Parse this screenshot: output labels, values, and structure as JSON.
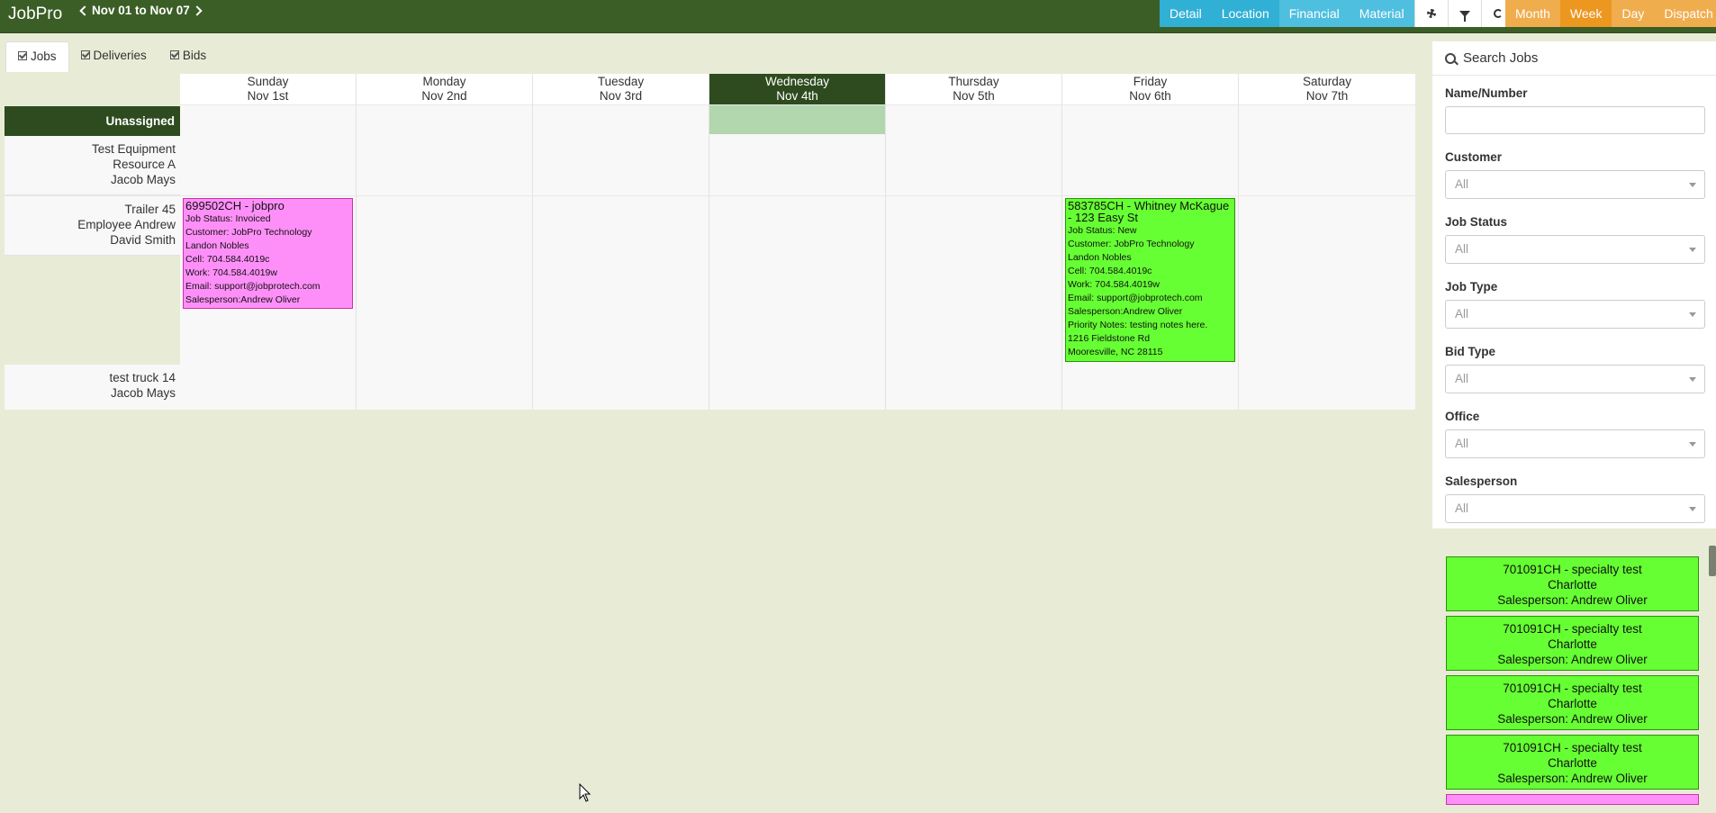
{
  "brand": "JobPro",
  "date_range": "Nov 01 to Nov 07",
  "view_buttons": [
    "Detail",
    "Location",
    "Financial",
    "Material"
  ],
  "icon_buttons": [
    "gear-icon",
    "filter-icon",
    "refresh-icon"
  ],
  "period_buttons": [
    "Month",
    "Week",
    "Day",
    "Dispatch"
  ],
  "tabs": [
    "Jobs",
    "Deliveries",
    "Bids"
  ],
  "days": [
    {
      "name": "Sunday",
      "date": "Nov 1st"
    },
    {
      "name": "Monday",
      "date": "Nov 2nd"
    },
    {
      "name": "Tuesday",
      "date": "Nov 3rd"
    },
    {
      "name": "Wednesday",
      "date": "Nov 4th"
    },
    {
      "name": "Thursday",
      "date": "Nov 5th"
    },
    {
      "name": "Friday",
      "date": "Nov 6th"
    },
    {
      "name": "Saturday",
      "date": "Nov 7th"
    }
  ],
  "rows": {
    "unassigned": "Unassigned",
    "r1": [
      "Test Equipment",
      "Resource A",
      "Jacob Mays"
    ],
    "r2": [
      "Trailer 45",
      "Employee Andrew",
      "David Smith"
    ],
    "r3": [
      "test truck 14",
      "Jacob Mays"
    ]
  },
  "jobs": {
    "j1": {
      "title": "699502CH - jobpro",
      "lines": [
        "Job Status: Invoiced",
        "Customer: JobPro Technology",
        "Landon Nobles",
        "Cell: 704.584.4019c",
        "Work: 704.584.4019w",
        "Email: support@jobprotech.com",
        "Salesperson:Andrew Oliver"
      ]
    },
    "j2": {
      "title": "583785CH - Whitney McKague - 123 Easy St",
      "lines": [
        "Job Status: New",
        "Customer: JobPro Technology",
        "Landon Nobles",
        "Cell: 704.584.4019c",
        "Work: 704.584.4019w",
        "Email: support@jobprotech.com",
        "Salesperson:Andrew Oliver",
        "Priority Notes: testing notes here.",
        "1216 Fieldstone Rd",
        "Mooresville, NC 28115"
      ]
    }
  },
  "search": {
    "title": "Search Jobs",
    "name_label": "Name/Number",
    "name_value": "",
    "customer_label": "Customer",
    "customer_value": "All",
    "status_label": "Job Status",
    "status_value": "All",
    "type_label": "Job Type",
    "type_value": "All",
    "bid_label": "Bid Type",
    "bid_value": "All",
    "office_label": "Office",
    "office_value": "All",
    "sales_label": "Salesperson",
    "sales_value": "All"
  },
  "unassigned_list": [
    {
      "title": "701091CH - specialty test",
      "city": "Charlotte",
      "sales": "Salesperson: Andrew Oliver"
    },
    {
      "title": "701091CH - specialty test",
      "city": "Charlotte",
      "sales": "Salesperson: Andrew Oliver"
    },
    {
      "title": "701091CH - specialty test",
      "city": "Charlotte",
      "sales": "Salesperson: Andrew Oliver"
    },
    {
      "title": "701091CH - specialty test",
      "city": "Charlotte",
      "sales": "Salesperson: Andrew Oliver"
    }
  ],
  "colors": {
    "header": "#3b5e26",
    "today": "#2e4b1f",
    "info": "#31b0d5",
    "orange": "#f0ad4e",
    "job_green": "#66ff33",
    "job_pink": "#ff8ff8"
  }
}
